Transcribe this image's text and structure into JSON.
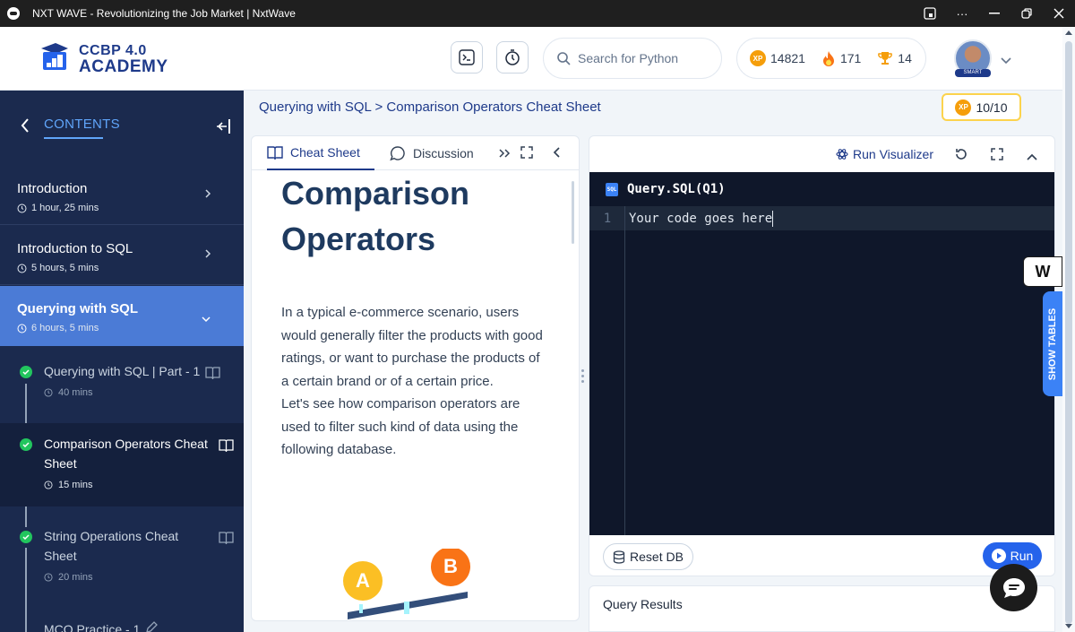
{
  "window": {
    "title": "NXT WAVE - Revolutionizing the Job Market | NxtWave",
    "more_label": "···"
  },
  "header": {
    "logo_line1": "CCBP 4.0",
    "logo_line2": "ACADEMY",
    "search_placeholder": "Search for Python",
    "stats": {
      "xp": "14821",
      "streak": "171",
      "trophies": "14"
    },
    "xp_badge_text": "XP",
    "avatar_tag": "SMART"
  },
  "sidebar": {
    "contents_label": "CONTENTS",
    "sections": [
      {
        "title": "Introduction",
        "duration": "1 hour, 25 mins"
      },
      {
        "title": "Introduction to SQL",
        "duration": "5 hours, 5 mins"
      },
      {
        "title": "Querying with SQL",
        "duration": "6 hours, 5 mins"
      }
    ],
    "lessons": [
      {
        "title": "Querying with SQL | Part - 1",
        "duration": "40 mins"
      },
      {
        "title": "Comparison Operators Cheat Sheet",
        "duration": "15 mins"
      },
      {
        "title": "String Operations Cheat Sheet",
        "duration": "20 mins"
      },
      {
        "title": "MCQ Practice - 1"
      }
    ]
  },
  "breadcrumb": "Querying with SQL > Comparison Operators Cheat Sheet",
  "score": "10/10",
  "left_panel": {
    "tabs": [
      "Cheat Sheet",
      "Discussion"
    ],
    "heading": "Comparison Operators",
    "paragraph1": "In a typical e-commerce scenario, users would generally filter the products with good ratings, or want to purchase the products of a certain brand or of a certain price.",
    "paragraph2": "Let's see how comparison operators are used to filter such kind of data using the following database.",
    "illustration_labels": [
      "A",
      "B"
    ]
  },
  "editor": {
    "run_visualizer_label": "Run Visualizer",
    "file_title": "Query.SQL(Q1)",
    "sql_icon_text": "SQL",
    "lines": [
      {
        "number": "1",
        "code": "Your code goes here"
      }
    ],
    "reset_label": "Reset DB",
    "run_label": "Run"
  },
  "results": {
    "title": "Query Results"
  },
  "floating": {
    "show_tables_label": "SHOW TABLES",
    "w_badge": "W"
  }
}
